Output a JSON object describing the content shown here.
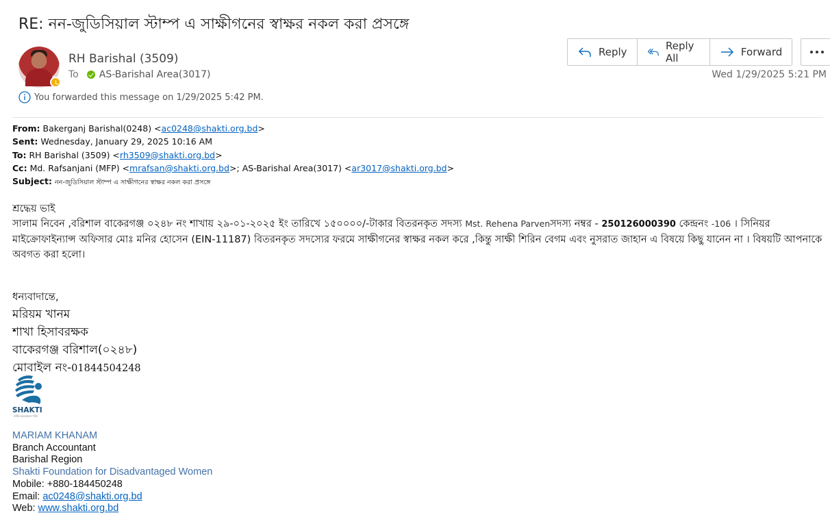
{
  "email": {
    "subject": "RE:  নন-জুডিসিয়াল স্টাম্প এ সাক্ষীগনের স্বাক্ষর নকল করা প্রসঙ্গে",
    "sender": "RH Barishal (3509)",
    "to_label": "To",
    "to_recipient": "AS-Barishal Area(3017)",
    "forward_note": "You forwarded this message on 1/29/2025 5:42 PM.",
    "date": "Wed 1/29/2025 5:21 PM"
  },
  "actions": {
    "reply": "Reply",
    "reply_all": "Reply All",
    "forward": "Forward",
    "more_icon": "more-icon"
  },
  "quoted_header": {
    "from_label": "From:",
    "from_name": "Bakerganj Barishal(0248) <",
    "from_email": "ac0248@shakti.org.bd",
    "sent_label": "Sent:",
    "sent_value": "Wednesday, January 29, 2025 10:16 AM",
    "to_label": "To:",
    "to_name": "RH Barishal (3509) <",
    "to_email": "rh3509@shakti.org.bd",
    "cc_label": "Cc:",
    "cc_name1": "Md. Rafsanjani (MFP) <",
    "cc_email1": "mrafsan@shakti.org.bd",
    "cc_name2": ">; AS-Barishal Area(3017) <",
    "cc_email2": "ar3017@shakti.org.bd",
    "subject_label": "Subject:",
    "subject_value": "নন-জুডিসিয়াল স্টাম্প এ সাক্ষীগনের স্বাক্ষর নকল করা প্রসঙ্গে"
  },
  "body": {
    "greeting": "শ্রদ্ধেয় ভাই",
    "p1_a": "সালাম নিবেন ,বরিশাল বাকেরগঞ্জ ০২৪৮ নং শাখায়  ২৯-০১-২০২৫ ইং তারিখে ১৫০০০০/-টাকার  বিতরনকৃত সদস্য ",
    "p1_name": "Mst. Rehena Parven",
    "p1_b": "সদস্য নম্বর - ",
    "p1_num": "250126000390",
    "p1_c": " কেন্দ্রনং ",
    "p1_center": "-106",
    "p1_d": " । সিনিয়র মাইক্রোফাইন্যান্স অফিসার  মোঃ মনির হোসেন (EIN-11187)  বিতরনকৃত সদস্যের ফরমে সাক্ষীগনের স্বাক্ষর নকল করে ,কিন্তু সাক্ষী শিরিন বেগম এবং নুসরাত জাহান এ বিষয়ে কিছু যানেন না । বিষয়টি আপনাকে অবগত করা হলো।"
  },
  "regards": {
    "thanks": "ধন্যবাদান্তে,",
    "name": "মরিয়ম খানম",
    "role": "শাখা হিসাবরক্ষক",
    "branch": "বাকেরগঞ্জ বরিশাল(০২৪৮)",
    "mobile_label": "মোবাইল নং-",
    "mobile": "01844504248"
  },
  "logo": {
    "text": "SHAKTI",
    "tagline": "নারীর ক্ষমতায়নে শক্তি"
  },
  "signature": {
    "name": "MARIAM KHANAM",
    "title": "Branch Accountant",
    "region": "Barishal Region",
    "org": "Shakti Foundation for Disadvantaged Women",
    "mobile": "Mobile: +880-184450248",
    "email_label": "Email: ",
    "email": "ac0248@shakti.org.bd",
    "web_label": "Web: ",
    "web": "www.shakti.org.bd"
  },
  "colors": {
    "accent_blue": "#0f6cbd",
    "link": "#0563c1",
    "signature_blue": "#4472a8",
    "online_green": "#6bb700",
    "away_yellow": "#f2b20f"
  }
}
